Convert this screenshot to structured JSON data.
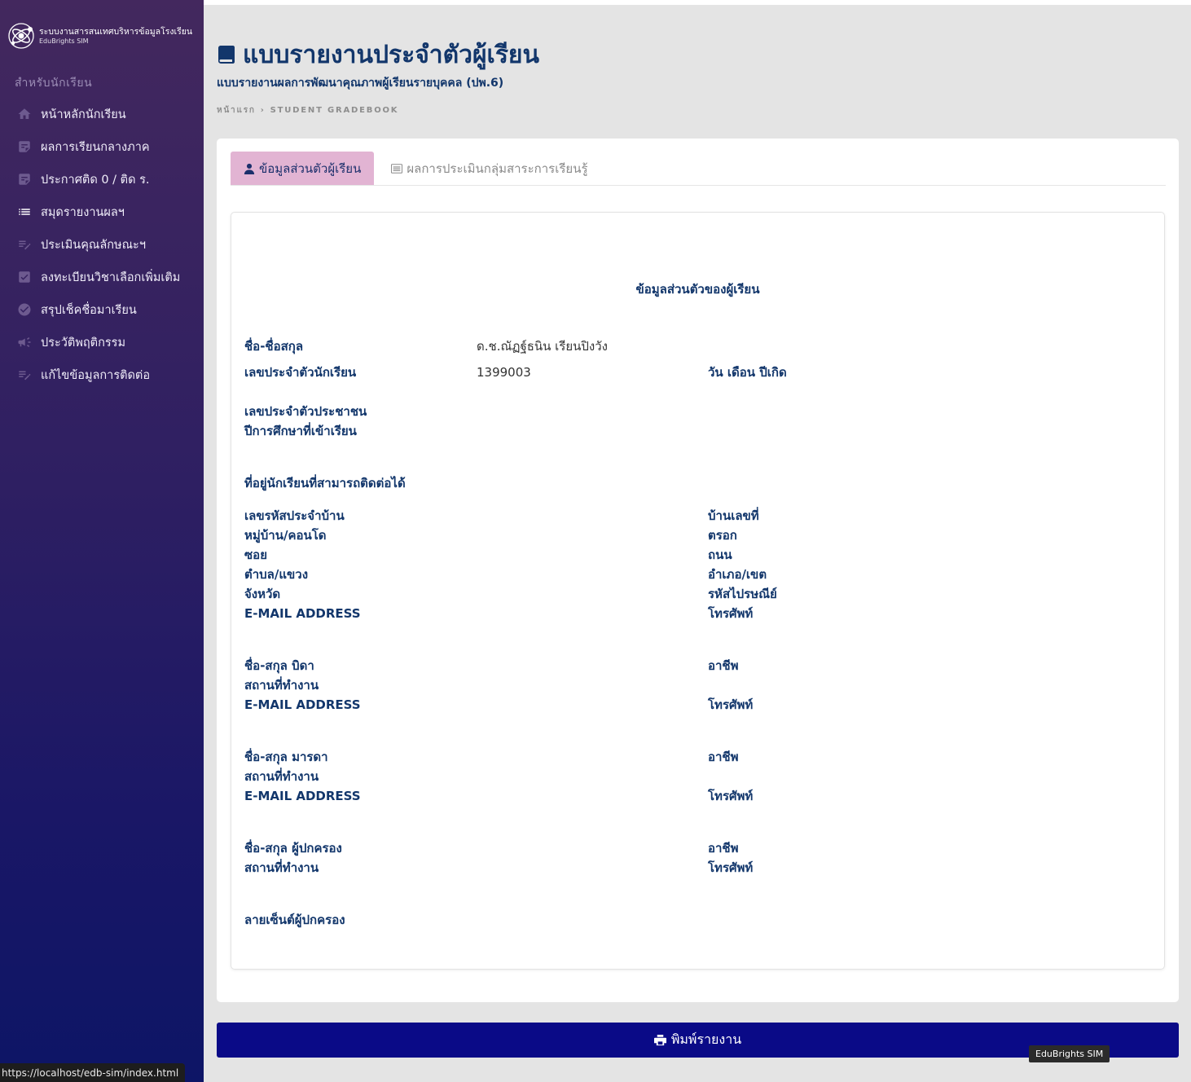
{
  "brand": {
    "title": "ระบบงานสารสนเทศบริหารข้อมูลโรงเรียน",
    "subtitle": "EduBrights SIM"
  },
  "sidebar": {
    "section_label": "สำหรับนักเรียน",
    "items": [
      {
        "label": "หน้าหลักนักเรียน",
        "icon": "home-icon"
      },
      {
        "label": "ผลการเรียนกลางภาค",
        "icon": "note-icon"
      },
      {
        "label": "ประกาศติด 0 / ติด ร.",
        "icon": "note-icon"
      },
      {
        "label": "สมุดรายงานผลฯ",
        "icon": "list-icon"
      },
      {
        "label": "ประเมินคุณลักษณะฯ",
        "icon": "edit-list-icon"
      },
      {
        "label": "ลงทะเบียนวิชาเลือกเพิ่มเติม",
        "icon": "checkbox-icon"
      },
      {
        "label": "สรุปเช็คชื่อมาเรียน",
        "icon": "check-circle-icon"
      },
      {
        "label": "ประวัติพฤติกรรม",
        "icon": "megaphone-icon"
      },
      {
        "label": "แก้ไขข้อมูลการติดต่อ",
        "icon": "edit-list-icon"
      }
    ]
  },
  "header": {
    "title": "แบบรายงานประจำตัวผู้เรียน",
    "subtitle": "แบบรายงานผลการพัฒนาคุณภาพผู้เรียนรายบุคคล (ปพ.6)",
    "breadcrumb": [
      "หน้าแรก",
      "STUDENT GRADEBOOK"
    ]
  },
  "tabs": [
    {
      "label": "ข้อมูลส่วนตัวผู้เรียน",
      "active": true
    },
    {
      "label": "ผลการประเมินกลุ่มสาระการเรียนรู้",
      "active": false
    }
  ],
  "student": {
    "section_title": "ข้อมูลส่วนตัวของผู้เรียน",
    "name_label": "ชื่อ-ชื่อสกุล",
    "name_value": "ด.ช.ณัฏฐ์ธนิน เรียนปิงวัง",
    "id_label": "เลขประจำตัวนักเรียน",
    "id_value": "1399003",
    "dob_label": "วัน เดือน ปีเกิด",
    "citizen_label": "เลขประจำตัวประชาชน",
    "year_label": "ปีการศึกษาที่เข้าเรียน",
    "address_heading": "ที่อยู่นักเรียนที่สามารถติดต่อได้",
    "house_code": "เลขรหัสประจำบ้าน",
    "house_no": "บ้านเลขที่",
    "village": "หมู่บ้าน/คอนโด",
    "alley": "ตรอก",
    "soi": "ซอย",
    "road": "ถนน",
    "subdistrict": "ตำบล/แขวง",
    "district": "อำเภอ/เขต",
    "province": "จังหวัด",
    "postal": "รหัสไปรษณีย์",
    "email": "E-MAIL ADDRESS",
    "phone": "โทรศัพท์",
    "father": "ชื่อ-สกุล บิดา",
    "mother": "ชื่อ-สกุล มารดา",
    "guardian": "ชื่อ-สกุล ผู้ปกครอง",
    "occupation": "อาชีพ",
    "workplace": "สถานที่ทำงาน",
    "signature": "ลายเซ็นต์ผู้ปกครอง"
  },
  "print_button": "พิมพ์รายงาน",
  "tooltip": "EduBrights SIM",
  "status_url": "https://localhost/edb-sim/index.html"
}
